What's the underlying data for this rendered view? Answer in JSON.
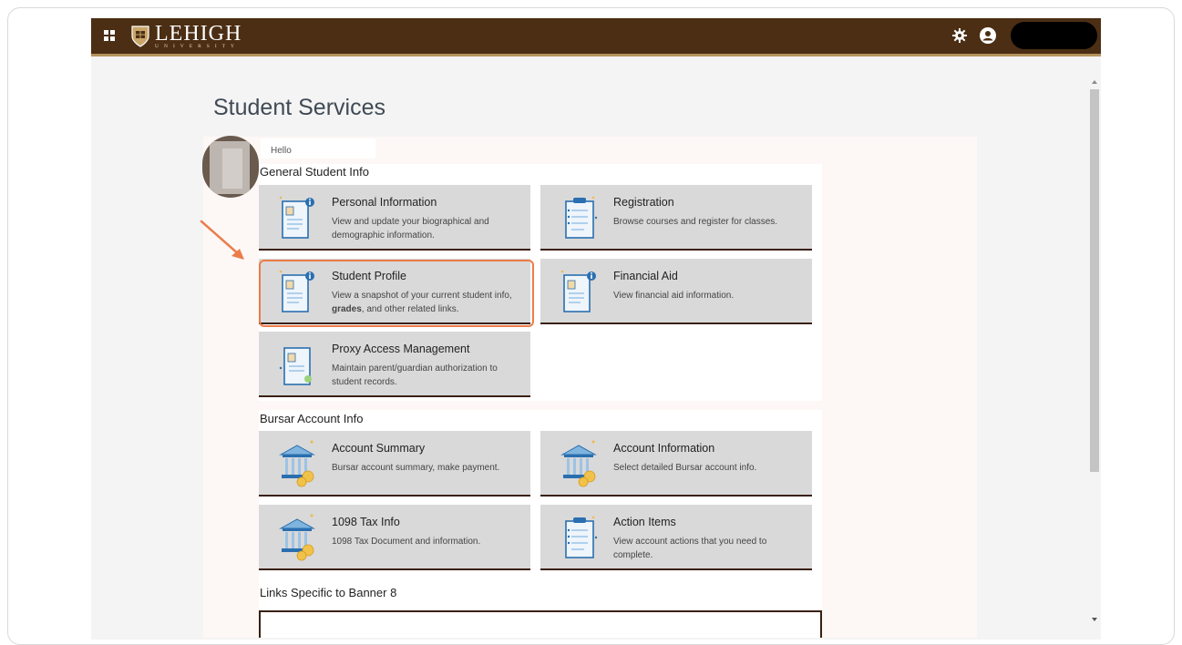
{
  "brand": {
    "name": "LEHIGH",
    "subtitle": "UNIVERSITY",
    "colors": {
      "header": "#4b2e14",
      "accent": "#b5945c",
      "highlight": "#ec7c4a"
    }
  },
  "header": {
    "menu_icon": "grid-menu-icon",
    "settings_icon": "gear-icon",
    "user_icon": "user-icon"
  },
  "page": {
    "title": "Student Services",
    "greeting": "Hello"
  },
  "sections": [
    {
      "title": "General Student Info",
      "cards": [
        {
          "title": "Personal Information",
          "desc": "View and update your biographical and demographic information.",
          "icon": "profile-document-icon"
        },
        {
          "title": "Registration",
          "desc": "Browse courses and register for classes.",
          "icon": "clipboard-icon"
        },
        {
          "title": "Student Profile",
          "desc_pre": "View a snapshot of your current student info, ",
          "desc_bold": "grades",
          "desc_post": ", and other related links.",
          "icon": "profile-document-icon"
        },
        {
          "title": "Financial Aid",
          "desc": "View financial aid information.",
          "icon": "profile-document-icon"
        },
        {
          "title": "Proxy Access Management",
          "desc": "Maintain parent/guardian authorization to student records.",
          "icon": "proxy-document-icon"
        }
      ]
    },
    {
      "title": "Bursar Account Info",
      "cards": [
        {
          "title": "Account Summary",
          "desc": "Bursar account summary, make payment.",
          "icon": "bank-icon"
        },
        {
          "title": "Account Information",
          "desc": "Select detailed Bursar account info.",
          "icon": "bank-icon"
        },
        {
          "title": "1098 Tax Info",
          "desc": "1098 Tax Document and information.",
          "icon": "bank-icon"
        },
        {
          "title": "Action Items",
          "desc": "View account actions that you need to complete.",
          "icon": "clipboard-icon"
        }
      ]
    },
    {
      "title": "Links Specific to Banner 8"
    }
  ]
}
